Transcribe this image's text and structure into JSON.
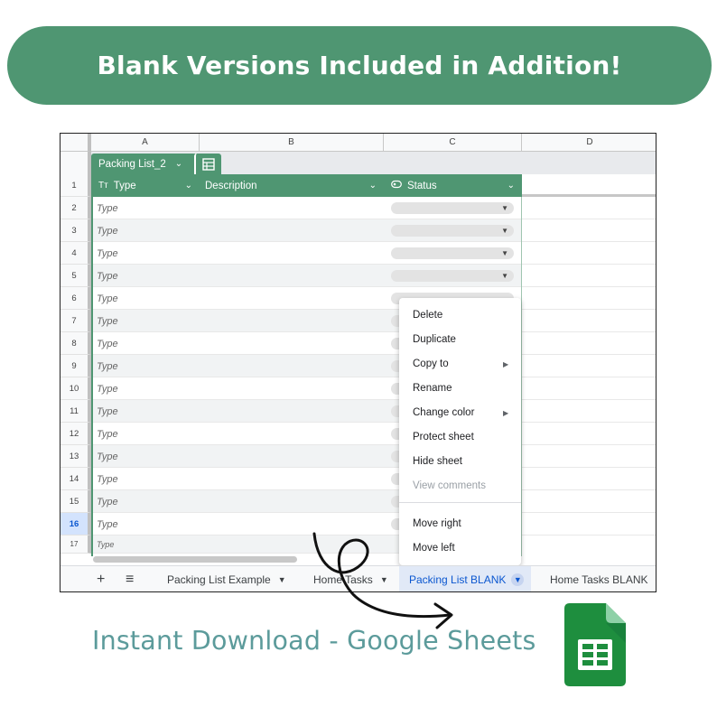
{
  "banner": {
    "text": "Blank Versions Included in Addition!"
  },
  "sheet": {
    "columns": [
      "A",
      "B",
      "C",
      "D"
    ],
    "table_name": "Packing List_2",
    "headers": {
      "type": "Type",
      "description": "Description",
      "status": "Status"
    },
    "header_icons": {
      "type": "text-type-icon",
      "status": "dropdown-type-icon"
    },
    "rows": [
      {
        "n": "1"
      },
      {
        "n": "2",
        "type": "Type"
      },
      {
        "n": "3",
        "type": "Type"
      },
      {
        "n": "4",
        "type": "Type"
      },
      {
        "n": "5",
        "type": "Type"
      },
      {
        "n": "6",
        "type": "Type"
      },
      {
        "n": "7",
        "type": "Type"
      },
      {
        "n": "8",
        "type": "Type"
      },
      {
        "n": "9",
        "type": "Type"
      },
      {
        "n": "10",
        "type": "Type"
      },
      {
        "n": "11",
        "type": "Type"
      },
      {
        "n": "12",
        "type": "Type"
      },
      {
        "n": "13",
        "type": "Type"
      },
      {
        "n": "14",
        "type": "Type"
      },
      {
        "n": "15",
        "type": "Type"
      },
      {
        "n": "16",
        "type": "Type"
      },
      {
        "n": "17",
        "type": "Type"
      }
    ],
    "selected_row": "16"
  },
  "context_menu": {
    "items": [
      "Delete",
      "Duplicate",
      "Copy to",
      "Rename",
      "Change color",
      "Protect sheet",
      "Hide sheet",
      "View comments",
      "Move right",
      "Move left"
    ],
    "disabled": [
      "View comments"
    ]
  },
  "tabs": {
    "add_label": "+",
    "list_label": "≡",
    "sheets": [
      "Packing List Example",
      "Home Tasks",
      "Packing List BLANK",
      "Home Tasks BLANK"
    ],
    "active": "Packing List BLANK"
  },
  "caption": {
    "text": "Instant Download - Google Sheets"
  },
  "colors": {
    "accent_green": "#4f9672",
    "caption_teal": "#5c9b9b",
    "sheets_green": "#1e8e3e"
  },
  "icons": {
    "logo": "google-sheets-icon",
    "arrow": "curly-arrow-icon"
  }
}
